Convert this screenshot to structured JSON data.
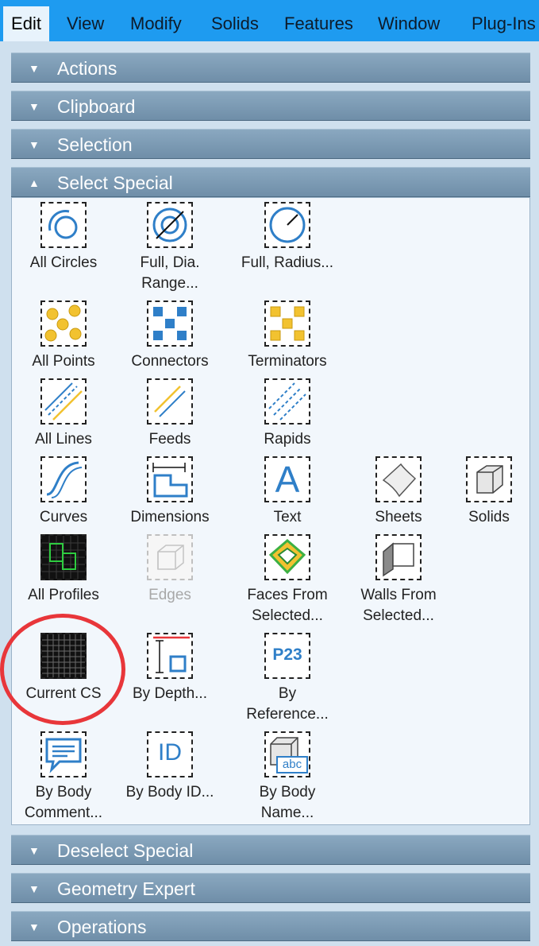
{
  "menubar": {
    "items": [
      "Edit",
      "View",
      "Modify",
      "Solids",
      "Features",
      "Window",
      "Plug-Ins"
    ],
    "active": "Edit"
  },
  "sections": {
    "actions": "Actions",
    "clipboard": "Clipboard",
    "selection": "Selection",
    "select_special": "Select Special",
    "deselect_special": "Deselect Special",
    "geometry_expert": "Geometry Expert",
    "operations": "Operations"
  },
  "tools": {
    "all_circles": "All Circles",
    "full_dia_range": "Full, Dia.\nRange...",
    "full_radius": "Full, Radius...",
    "all_points": "All Points",
    "connectors": "Connectors",
    "terminators": "Terminators",
    "all_lines": "All Lines",
    "feeds": "Feeds",
    "rapids": "Rapids",
    "curves": "Curves",
    "dimensions": "Dimensions",
    "text": "Text",
    "sheets": "Sheets",
    "solids": "Solids",
    "all_profiles": "All Profiles",
    "edges": "Edges",
    "faces_from_selected": "Faces From\nSelected...",
    "walls_from_selected": "Walls From\nSelected...",
    "current_cs": "Current CS",
    "by_depth": "By Depth...",
    "by_reference": "By\nReference...",
    "by_body_comment": "By Body\nComment...",
    "by_body_id": "By Body ID...",
    "by_body_name": "By Body\nName..."
  },
  "icon_text": {
    "text_icon": "A",
    "reference_icon": "P23",
    "id_icon": "ID",
    "name_icon": "abc"
  },
  "colors": {
    "menubar": "#1e9bf0",
    "header": "#7894ad",
    "icon_blue": "#2f7fc8",
    "icon_yellow": "#f2c230",
    "highlight": "#e8363a"
  }
}
